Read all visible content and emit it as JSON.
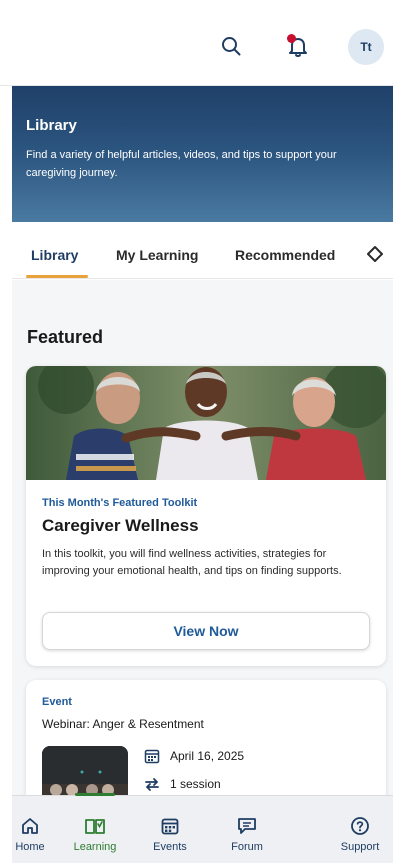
{
  "header": {
    "avatar_initials": "Tt",
    "icons": [
      "search-icon",
      "bell-icon"
    ],
    "notification_dot_color": "#c8102e"
  },
  "hero": {
    "title": "Library",
    "description": "Find a variety of helpful articles, videos, and tips to support your caregiving journey."
  },
  "tabs": [
    {
      "label": "Library",
      "active": true
    },
    {
      "label": "My Learning",
      "active": false
    },
    {
      "label": "Recommended",
      "active": false
    }
  ],
  "featured": {
    "section_title": "Featured",
    "kicker": "This Month's Featured Toolkit",
    "title": "Caregiver Wellness",
    "description": "In this toolkit, you will find wellness activities, strategies for improving your emotional health, and tips on finding supports.",
    "button_label": "View Now"
  },
  "event": {
    "kicker": "Event",
    "title": "Webinar: Anger & Resentment",
    "date": "April 16, 2025",
    "sessions": "1 session"
  },
  "bottom_nav": [
    {
      "label": "Home",
      "icon": "home-icon",
      "active": false
    },
    {
      "label": "Learning",
      "icon": "book-icon",
      "active": true
    },
    {
      "label": "Events",
      "icon": "calendar-icon",
      "active": false
    },
    {
      "label": "Forum",
      "icon": "chat-icon",
      "active": false
    },
    {
      "label": "Support",
      "icon": "help-icon",
      "active": false
    }
  ],
  "colors": {
    "primary": "#1f3d63",
    "accent_tab": "#e8a33d",
    "link": "#1f5a99",
    "active_nav": "#2e7d32"
  }
}
